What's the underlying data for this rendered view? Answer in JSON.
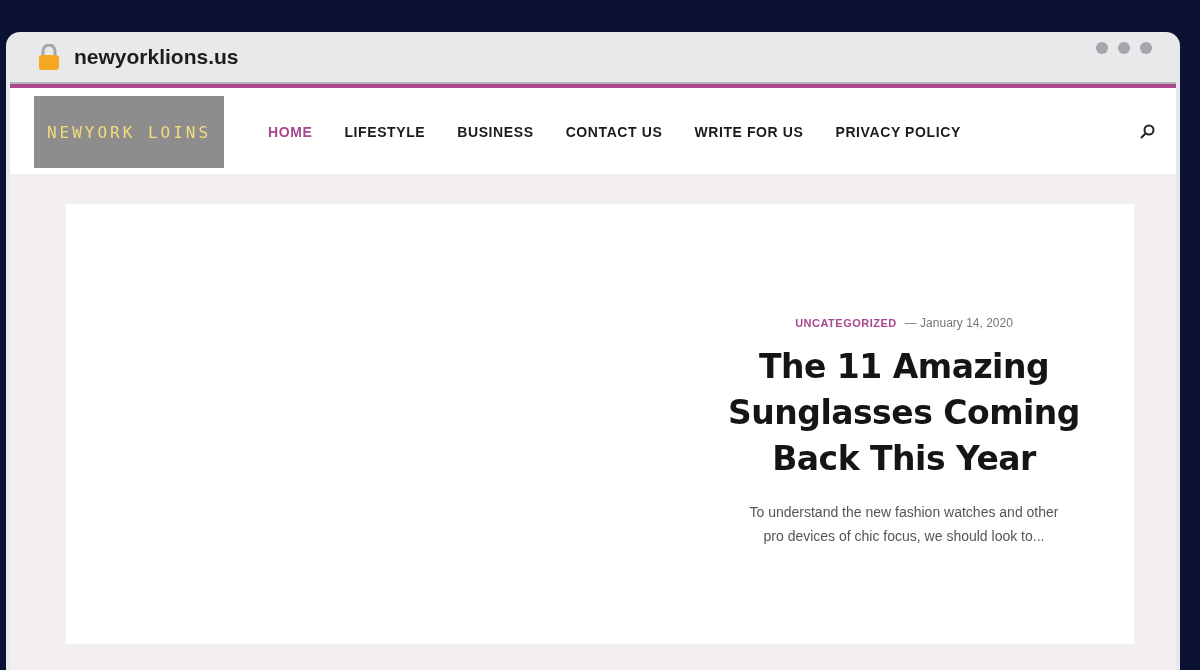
{
  "browser": {
    "address": "newyorklions.us"
  },
  "header": {
    "logo": "NEWYORK LOINS",
    "nav": [
      {
        "label": "HOME",
        "selected": true
      },
      {
        "label": "LIFESTYLE",
        "selected": false
      },
      {
        "label": "BUSINESS",
        "selected": false
      },
      {
        "label": "CONTACT US",
        "selected": false
      },
      {
        "label": "WRITE FOR US",
        "selected": false
      },
      {
        "label": "PRIVACY POLICY",
        "selected": false
      }
    ]
  },
  "post": {
    "category": "UNCATEGORIZED",
    "date": "— January 14, 2020",
    "title": "The 11 Amazing Sunglasses Coming Back This Year",
    "excerpt": "To understand the new fashion watches and other pro devices of chic focus, we should look to..."
  }
}
